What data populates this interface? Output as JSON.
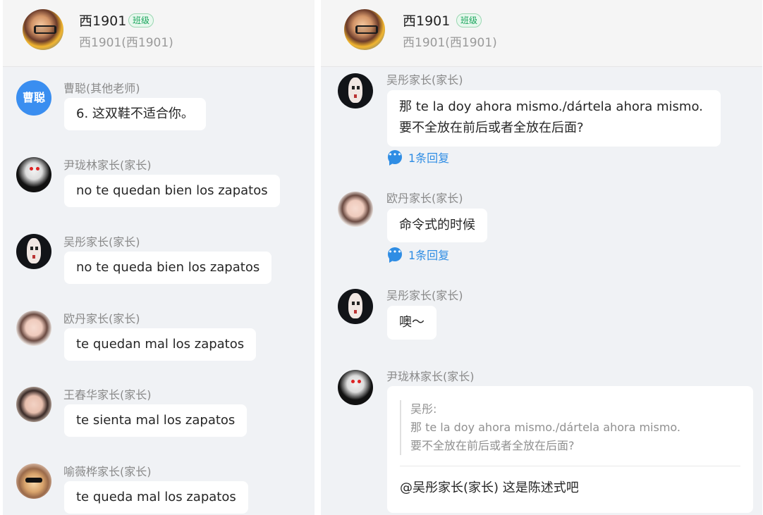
{
  "left": {
    "header": {
      "name": "西1901",
      "badge": "班级",
      "sub": "西1901(西1901)"
    },
    "messages": [
      {
        "sender": "曹聪(其他老师)",
        "avatar_text": "曹聪",
        "text": "6. 这双鞋不适合你。"
      },
      {
        "sender": "尹珑林家长(家长)",
        "text": "no te quedan bien los zapatos"
      },
      {
        "sender": "吴彤家长(家长)",
        "text": " no te queda bien los zapatos"
      },
      {
        "sender": "欧丹家长(家长)",
        "text": "te quedan  mal los zapatos"
      },
      {
        "sender": "王春华家长(家长)",
        "text": "te sienta mal los zapatos"
      },
      {
        "sender": "喻薇桦家长(家长)",
        "text": "te queda mal los zapatos"
      }
    ]
  },
  "right": {
    "header": {
      "name": "西1901",
      "badge": "班级",
      "sub": "西1901(西1901)"
    },
    "messages": [
      {
        "sender": "吴彤家长(家长)",
        "line1": "那 te la doy ahora mismo./dártela ahora mismo.",
        "line2": "要不全放在前后或者全放在后面?",
        "replies": "1条回复"
      },
      {
        "sender": "欧丹家长(家长)",
        "text": "命令式的时候",
        "replies": "1条回复"
      },
      {
        "sender": "吴彤家长(家长)",
        "text": "噢～"
      },
      {
        "sender": "尹珑林家长(家长)",
        "quote": {
          "author": "吴彤:",
          "line1": "那 te la doy ahora mismo./dártela ahora mismo.",
          "line2": "要不全放在前后或者全放在后面?"
        },
        "reply": "@吴彤家长(家长) 这是陈述式吧"
      }
    ]
  },
  "colors": {
    "accent": "#2f8de4",
    "badge_green": "#1aa55c",
    "panel_bg": "#f0f2f5",
    "bubble_bg": "#ffffff"
  },
  "icons": {
    "reply": "chat-bubble-icon"
  }
}
